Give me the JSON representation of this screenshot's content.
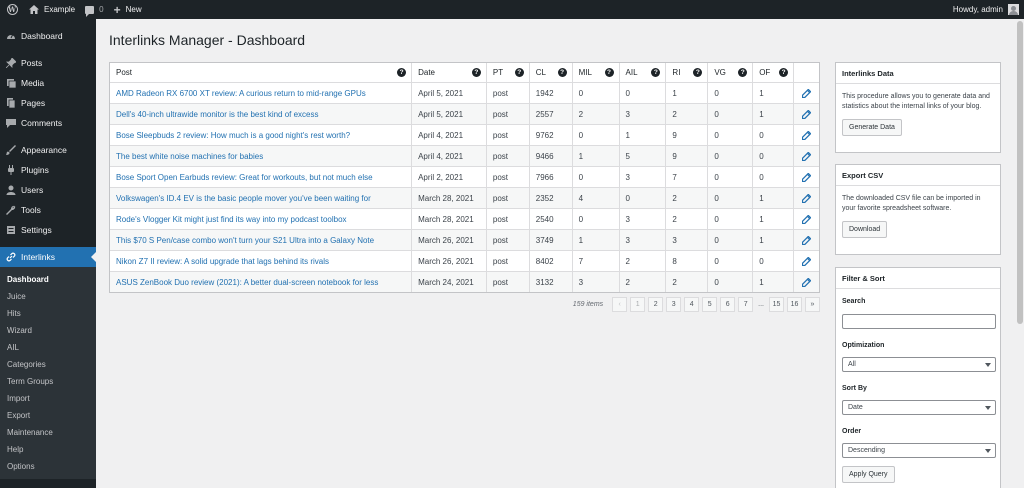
{
  "adminbar": {
    "site_name": "Example",
    "comments_count": "0",
    "new_label": "New",
    "howdy": "Howdy, admin"
  },
  "sidebar": {
    "items": [
      {
        "label": "Dashboard",
        "icon": "dashboard-icon"
      },
      {
        "label": "Posts",
        "icon": "pin-icon"
      },
      {
        "label": "Media",
        "icon": "media-icon"
      },
      {
        "label": "Pages",
        "icon": "pages-icon"
      },
      {
        "label": "Comments",
        "icon": "comments-icon"
      },
      {
        "label": "Appearance",
        "icon": "brush-icon"
      },
      {
        "label": "Plugins",
        "icon": "plugin-icon"
      },
      {
        "label": "Users",
        "icon": "users-icon"
      },
      {
        "label": "Tools",
        "icon": "wrench-icon"
      },
      {
        "label": "Settings",
        "icon": "settings-icon"
      },
      {
        "label": "Interlinks",
        "icon": "link-icon"
      }
    ],
    "submenu": [
      "Dashboard",
      "Juice",
      "Hits",
      "Wizard",
      "AIL",
      "Categories",
      "Term Groups",
      "Import",
      "Export",
      "Maintenance",
      "Help",
      "Options"
    ],
    "accent_color": "#2271b1"
  },
  "page": {
    "title": "Interlinks Manager - Dashboard"
  },
  "table": {
    "headers": {
      "post": "Post",
      "date": "Date",
      "pt": "PT",
      "cl": "CL",
      "mil": "MIL",
      "ail": "AIL",
      "ri": "RI",
      "vg": "VG",
      "of": "OF"
    },
    "rows": [
      {
        "post": "AMD Radeon RX 6700 XT review: A curious return to mid-range GPUs",
        "date": "April 5, 2021",
        "pt": "post",
        "cl": "1942",
        "mil": "0",
        "ail": "0",
        "ri": "1",
        "vg": "0",
        "of": "1"
      },
      {
        "post": "Dell's 40-inch ultrawide monitor is the best kind of excess",
        "date": "April 5, 2021",
        "pt": "post",
        "cl": "2557",
        "mil": "2",
        "ail": "3",
        "ri": "2",
        "vg": "0",
        "of": "1"
      },
      {
        "post": "Bose Sleepbuds 2 review: How much is a good night's rest worth?",
        "date": "April 4, 2021",
        "pt": "post",
        "cl": "9762",
        "mil": "0",
        "ail": "1",
        "ri": "9",
        "vg": "0",
        "of": "0"
      },
      {
        "post": "The best white noise machines for babies",
        "date": "April 4, 2021",
        "pt": "post",
        "cl": "9466",
        "mil": "1",
        "ail": "5",
        "ri": "9",
        "vg": "0",
        "of": "0"
      },
      {
        "post": "Bose Sport Open Earbuds review: Great for workouts, but not much else",
        "date": "April 2, 2021",
        "pt": "post",
        "cl": "7966",
        "mil": "0",
        "ail": "3",
        "ri": "7",
        "vg": "0",
        "of": "0"
      },
      {
        "post": "Volkswagen's ID.4 EV is the basic people mover you've been waiting for",
        "date": "March 28, 2021",
        "pt": "post",
        "cl": "2352",
        "mil": "4",
        "ail": "0",
        "ri": "2",
        "vg": "0",
        "of": "1"
      },
      {
        "post": "Rode's Vlogger Kit might just find its way into my podcast toolbox",
        "date": "March 28, 2021",
        "pt": "post",
        "cl": "2540",
        "mil": "0",
        "ail": "3",
        "ri": "2",
        "vg": "0",
        "of": "1"
      },
      {
        "post": "This $70 S Pen/case combo won't turn your S21 Ultra into a Galaxy Note",
        "date": "March 26, 2021",
        "pt": "post",
        "cl": "3749",
        "mil": "1",
        "ail": "3",
        "ri": "3",
        "vg": "0",
        "of": "1"
      },
      {
        "post": "Nikon Z7 II review: A solid upgrade that lags behind its rivals",
        "date": "March 26, 2021",
        "pt": "post",
        "cl": "8402",
        "mil": "7",
        "ail": "2",
        "ri": "8",
        "vg": "0",
        "of": "0"
      },
      {
        "post": "ASUS ZenBook Duo review (2021): A better dual-screen notebook for less",
        "date": "March 24, 2021",
        "pt": "post",
        "cl": "3132",
        "mil": "3",
        "ail": "2",
        "ri": "2",
        "vg": "0",
        "of": "1"
      }
    ]
  },
  "pagination": {
    "items": "159 items",
    "prev": "‹",
    "pages": [
      "1",
      "2",
      "3",
      "4",
      "5",
      "6",
      "7",
      "...",
      "15",
      "16"
    ],
    "next": "»"
  },
  "boxes": {
    "interlinks_data": {
      "title": "Interlinks Data",
      "text": "This procedure allows you to generate data and statistics about the internal links of your blog.",
      "button": "Generate Data"
    },
    "export_csv": {
      "title": "Export CSV",
      "text": "The downloaded CSV file can be imported in your favorite spreadsheet software.",
      "button": "Download"
    },
    "filter_sort": {
      "title": "Filter & Sort",
      "search_label": "Search",
      "optimization_label": "Optimization",
      "optimization_value": "All",
      "sort_by_label": "Sort By",
      "sort_by_value": "Date",
      "order_label": "Order",
      "order_value": "Descending",
      "button": "Apply Query"
    }
  }
}
